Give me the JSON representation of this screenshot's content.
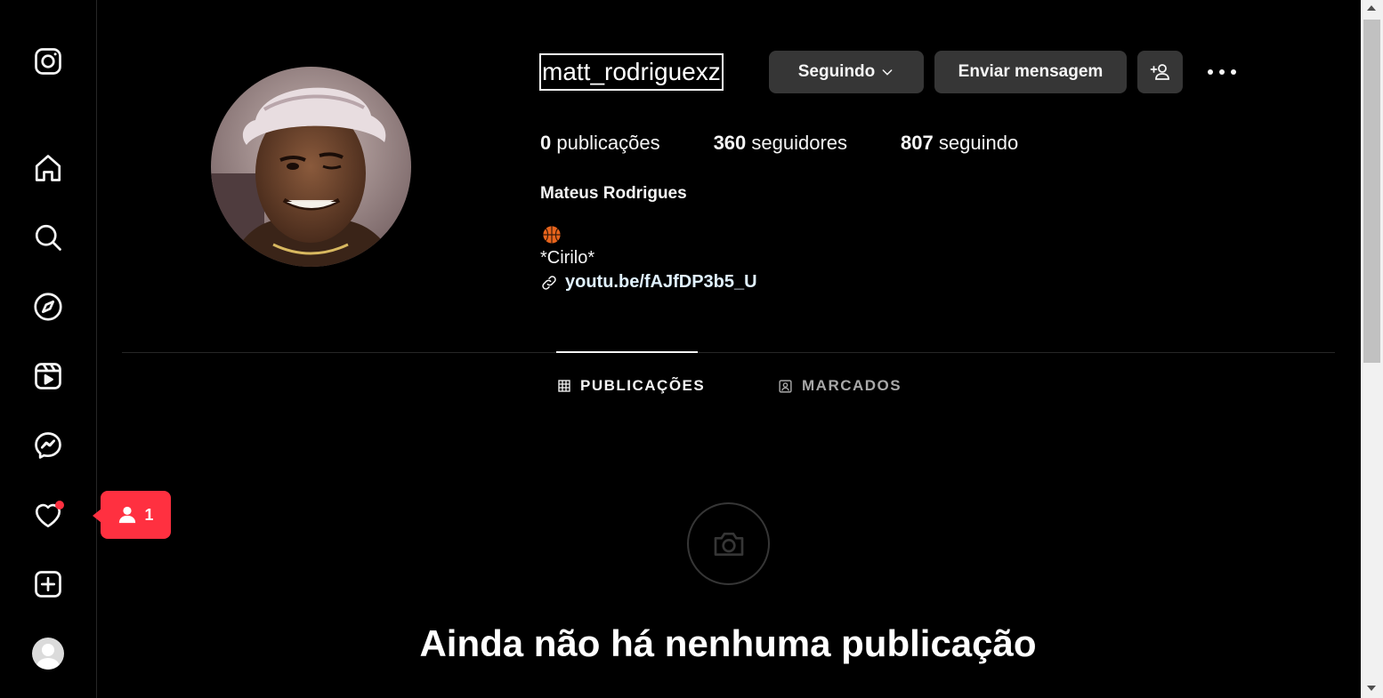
{
  "colors": {
    "background": "#000000",
    "button_bg": "#363636",
    "notification_red": "#ff3040",
    "link_color": "#e0f1ff",
    "inactive_tab": "#a8a8a8"
  },
  "sidebar": {
    "items": [
      {
        "name": "instagram-logo-icon"
      },
      {
        "name": "home-icon"
      },
      {
        "name": "search-icon"
      },
      {
        "name": "explore-compass-icon"
      },
      {
        "name": "reels-icon"
      },
      {
        "name": "messenger-icon"
      },
      {
        "name": "heart-notifications-icon"
      },
      {
        "name": "create-plus-icon"
      },
      {
        "name": "profile-avatar"
      }
    ]
  },
  "notification_tooltip": {
    "icon": "person-icon",
    "count": "1"
  },
  "profile": {
    "username": "matt_rodriguexz",
    "following_button": "Seguindo",
    "message_button": "Enviar mensagem",
    "stats": {
      "posts_count": "0",
      "posts_label": "publicações",
      "followers_count": "360",
      "followers_label": "seguidores",
      "following_count": "807",
      "following_label": "seguindo"
    },
    "full_name": "Mateus Rodrigues",
    "bio_emoji": "basketball-icon",
    "bio_line": "*Cirilo*",
    "bio_link": "youtu.be/fAJfDP3b5_U"
  },
  "tabs": [
    {
      "label": "PUBLICAÇÕES",
      "active": true
    },
    {
      "label": "MARCADOS",
      "active": false
    }
  ],
  "empty_state": {
    "title": "Ainda não há nenhuma publicação"
  }
}
